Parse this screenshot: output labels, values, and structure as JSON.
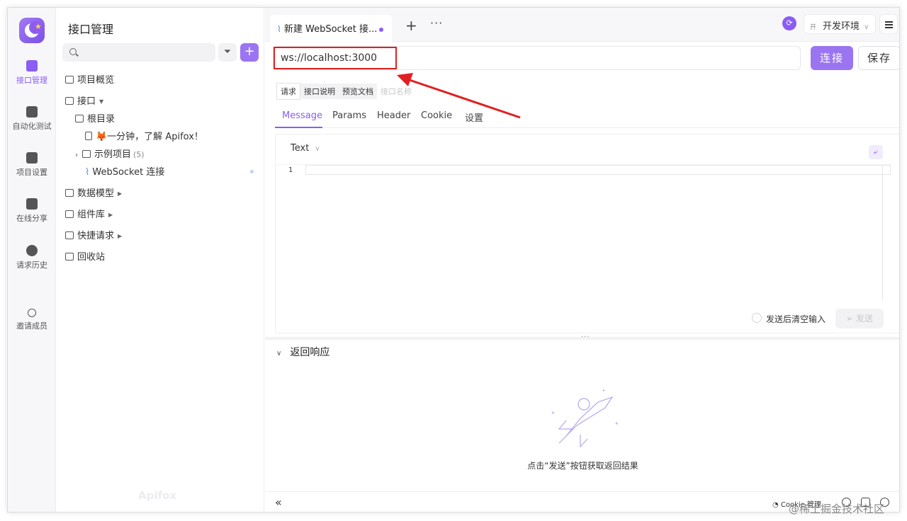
{
  "rail": {
    "items": [
      {
        "label": "接口管理",
        "icon": "api-icon",
        "active": true
      },
      {
        "label": "自动化测试",
        "icon": "automation-icon"
      },
      {
        "label": "项目设置",
        "icon": "settings-icon"
      },
      {
        "label": "在线分享",
        "icon": "share-icon"
      },
      {
        "label": "请求历史",
        "icon": "history-icon"
      },
      {
        "label": "邀请成员",
        "icon": "invite-icon"
      }
    ]
  },
  "tree": {
    "title": "接口管理",
    "search_placeholder": "",
    "nodes": [
      {
        "label": "项目概览"
      },
      {
        "label": "接口"
      },
      {
        "label": "根目录"
      },
      {
        "label": "🦊一分钟，了解 Apifox！"
      },
      {
        "label": "示例项目",
        "count": "(5)"
      },
      {
        "label": "WebSocket 连接"
      },
      {
        "label": "数据模型"
      },
      {
        "label": "组件库"
      },
      {
        "label": "快捷请求"
      },
      {
        "label": "回收站"
      }
    ],
    "brand": "Apifox"
  },
  "tabs": {
    "active_tab": "新建 WebSocket 接...",
    "add": "+",
    "more": "···"
  },
  "env": {
    "badge": "开",
    "name": "开发环境"
  },
  "request": {
    "url": "ws://localhost:3000",
    "connect_label": "连接",
    "save_label": "保存"
  },
  "subtabs": {
    "items": [
      "请求",
      "接口说明",
      "预览文档"
    ],
    "name_placeholder": "接口名称"
  },
  "reqtabs": [
    "Message",
    "Params",
    "Header",
    "Cookie",
    "设置"
  ],
  "editor": {
    "format": "Text",
    "line_number": "1",
    "clear_after_send": "发送后清空输入",
    "send_label": "发送"
  },
  "response": {
    "title": "返回响应",
    "empty_text": "点击“发送”按钮获取返回结果"
  },
  "statusbar": {
    "collapse": "«",
    "cookie": "Cookie 管理"
  },
  "watermark": "@稀土掘金技术社区",
  "colors": {
    "accent": "#8b5cf6",
    "annotation": "#e02020"
  }
}
